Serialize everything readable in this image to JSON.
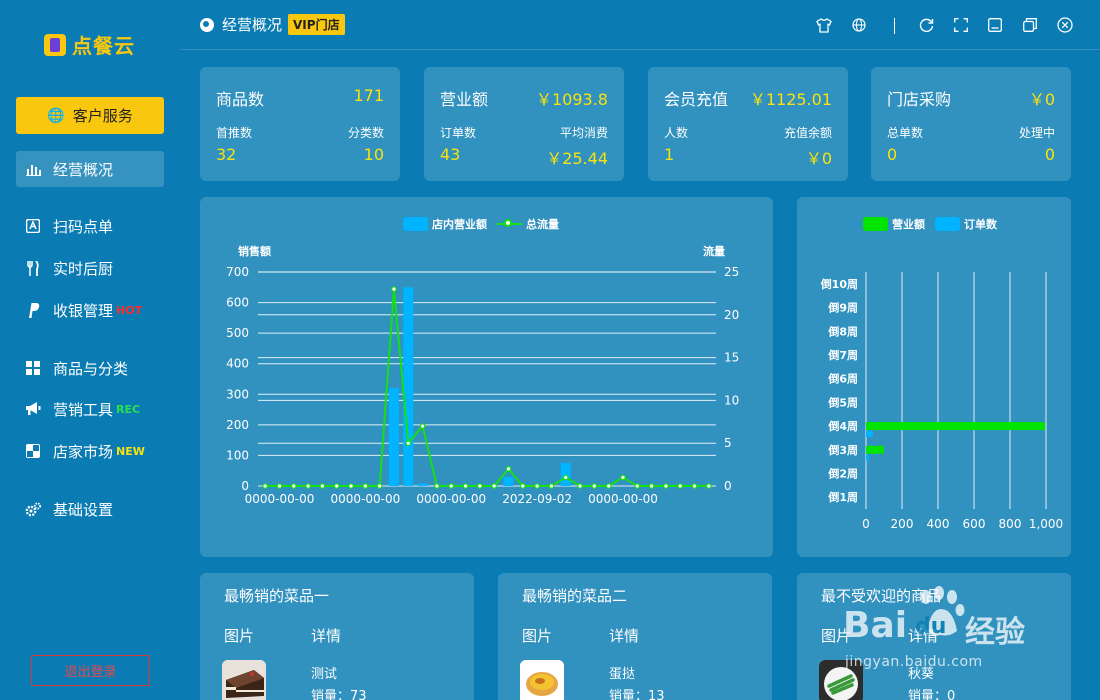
{
  "sidebar": {
    "logo_text": "点餐云",
    "service_button": "客户服务",
    "items": [
      {
        "label": "经营概况"
      },
      {
        "label": "扫码点单"
      },
      {
        "label": "实时后厨"
      },
      {
        "label": "收银管理",
        "tag": "HOT"
      },
      {
        "label": "商品与分类"
      },
      {
        "label": "营销工具",
        "tag": "REC"
      },
      {
        "label": "店家市场",
        "tag": "NEW"
      },
      {
        "label": "基础设置"
      }
    ],
    "logout": "退出登录"
  },
  "header": {
    "title": "经营概况",
    "badge": "VIP门店"
  },
  "cards": [
    {
      "title": "商品数",
      "value": "171",
      "sub": [
        {
          "label": "首推数",
          "value": "32"
        },
        {
          "label": "分类数",
          "value": "10"
        }
      ]
    },
    {
      "title": "营业额",
      "value": "￥1093.8",
      "sub": [
        {
          "label": "订单数",
          "value": "43"
        },
        {
          "label": "平均消费",
          "value": "￥25.44"
        }
      ]
    },
    {
      "title": "会员充值",
      "value": "￥1125.01",
      "sub": [
        {
          "label": "人数",
          "value": "1"
        },
        {
          "label": "充值余额",
          "value": "￥0"
        }
      ]
    },
    {
      "title": "门店采购",
      "value": "￥0",
      "sub": [
        {
          "label": "总单数",
          "value": "0"
        },
        {
          "label": "处理中",
          "value": "0"
        }
      ]
    }
  ],
  "colors": {
    "background": "#0a7cb3",
    "accent_yellow": "#f9c80e",
    "value_yellow": "#f9e20e",
    "bar_blue": "#00b4ff",
    "line_green": "#14e014",
    "hbar_green": "#00e400"
  },
  "chart_data": [
    {
      "type": "bar",
      "legend": [
        "店内营业额",
        "总流量"
      ],
      "ylabel": "销售额",
      "y2label": "流量",
      "ylim": [
        0,
        700
      ],
      "y2lim": [
        0,
        25
      ],
      "yticks": [
        "700",
        "600",
        "500",
        "400",
        "300",
        "200",
        "100",
        "0"
      ],
      "y2ticks": [
        "25",
        "20",
        "15",
        "10",
        "5",
        "0"
      ],
      "xtick_labels": [
        "0000-00-00",
        "0000-00-00",
        "0000-00-00",
        "2022-09-02",
        "0000-00-00"
      ],
      "series": [
        {
          "name": "店内营业额",
          "type": "bar",
          "values": [
            0,
            0,
            0,
            0,
            0,
            0,
            0,
            0,
            0,
            320,
            650,
            8,
            0,
            0,
            0,
            0,
            0,
            30,
            0,
            0,
            0,
            75,
            0,
            0,
            0,
            0,
            0,
            0,
            0,
            0,
            0,
            0
          ]
        },
        {
          "name": "总流量",
          "type": "line",
          "values": [
            0,
            0,
            0,
            0,
            0,
            0,
            0,
            0,
            0,
            23,
            5,
            7,
            0,
            0,
            0,
            0,
            0,
            2,
            0,
            0,
            0,
            1,
            0,
            0,
            0,
            1,
            0,
            0,
            0,
            0,
            0,
            0
          ]
        }
      ]
    },
    {
      "type": "bar",
      "legend": [
        "营业额",
        "订单数"
      ],
      "categories": [
        "倒10周",
        "倒9周",
        "倒8周",
        "倒7周",
        "倒6周",
        "倒5周",
        "倒4周",
        "倒3周",
        "倒2周",
        "倒1周"
      ],
      "xticks": [
        "0",
        "200",
        "400",
        "600",
        "800",
        "1,000"
      ],
      "xlim": [
        0,
        1000
      ],
      "series": [
        {
          "name": "营业额",
          "values": [
            0,
            0,
            0,
            0,
            0,
            0,
            995,
            100,
            0,
            0
          ]
        },
        {
          "name": "订单数",
          "values": [
            0,
            0,
            0,
            0,
            0,
            0,
            38,
            5,
            0,
            0
          ]
        }
      ]
    }
  ],
  "bottom": [
    {
      "title": "最畅销的菜品一",
      "col1": "图片",
      "col2": "详情",
      "name": "测试",
      "sales": "销量：73"
    },
    {
      "title": "最畅销的菜品二",
      "col1": "图片",
      "col2": "详情",
      "name": "蛋挞",
      "sales": "销量：13"
    },
    {
      "title": "最不受欢迎的商品",
      "col1": "图片",
      "col2": "详情",
      "name": "秋葵",
      "sales": "销量：0"
    }
  ],
  "watermark": {
    "brand": "Bai",
    "brand_cn": "经验",
    "url": "jingyan.baidu.com"
  }
}
